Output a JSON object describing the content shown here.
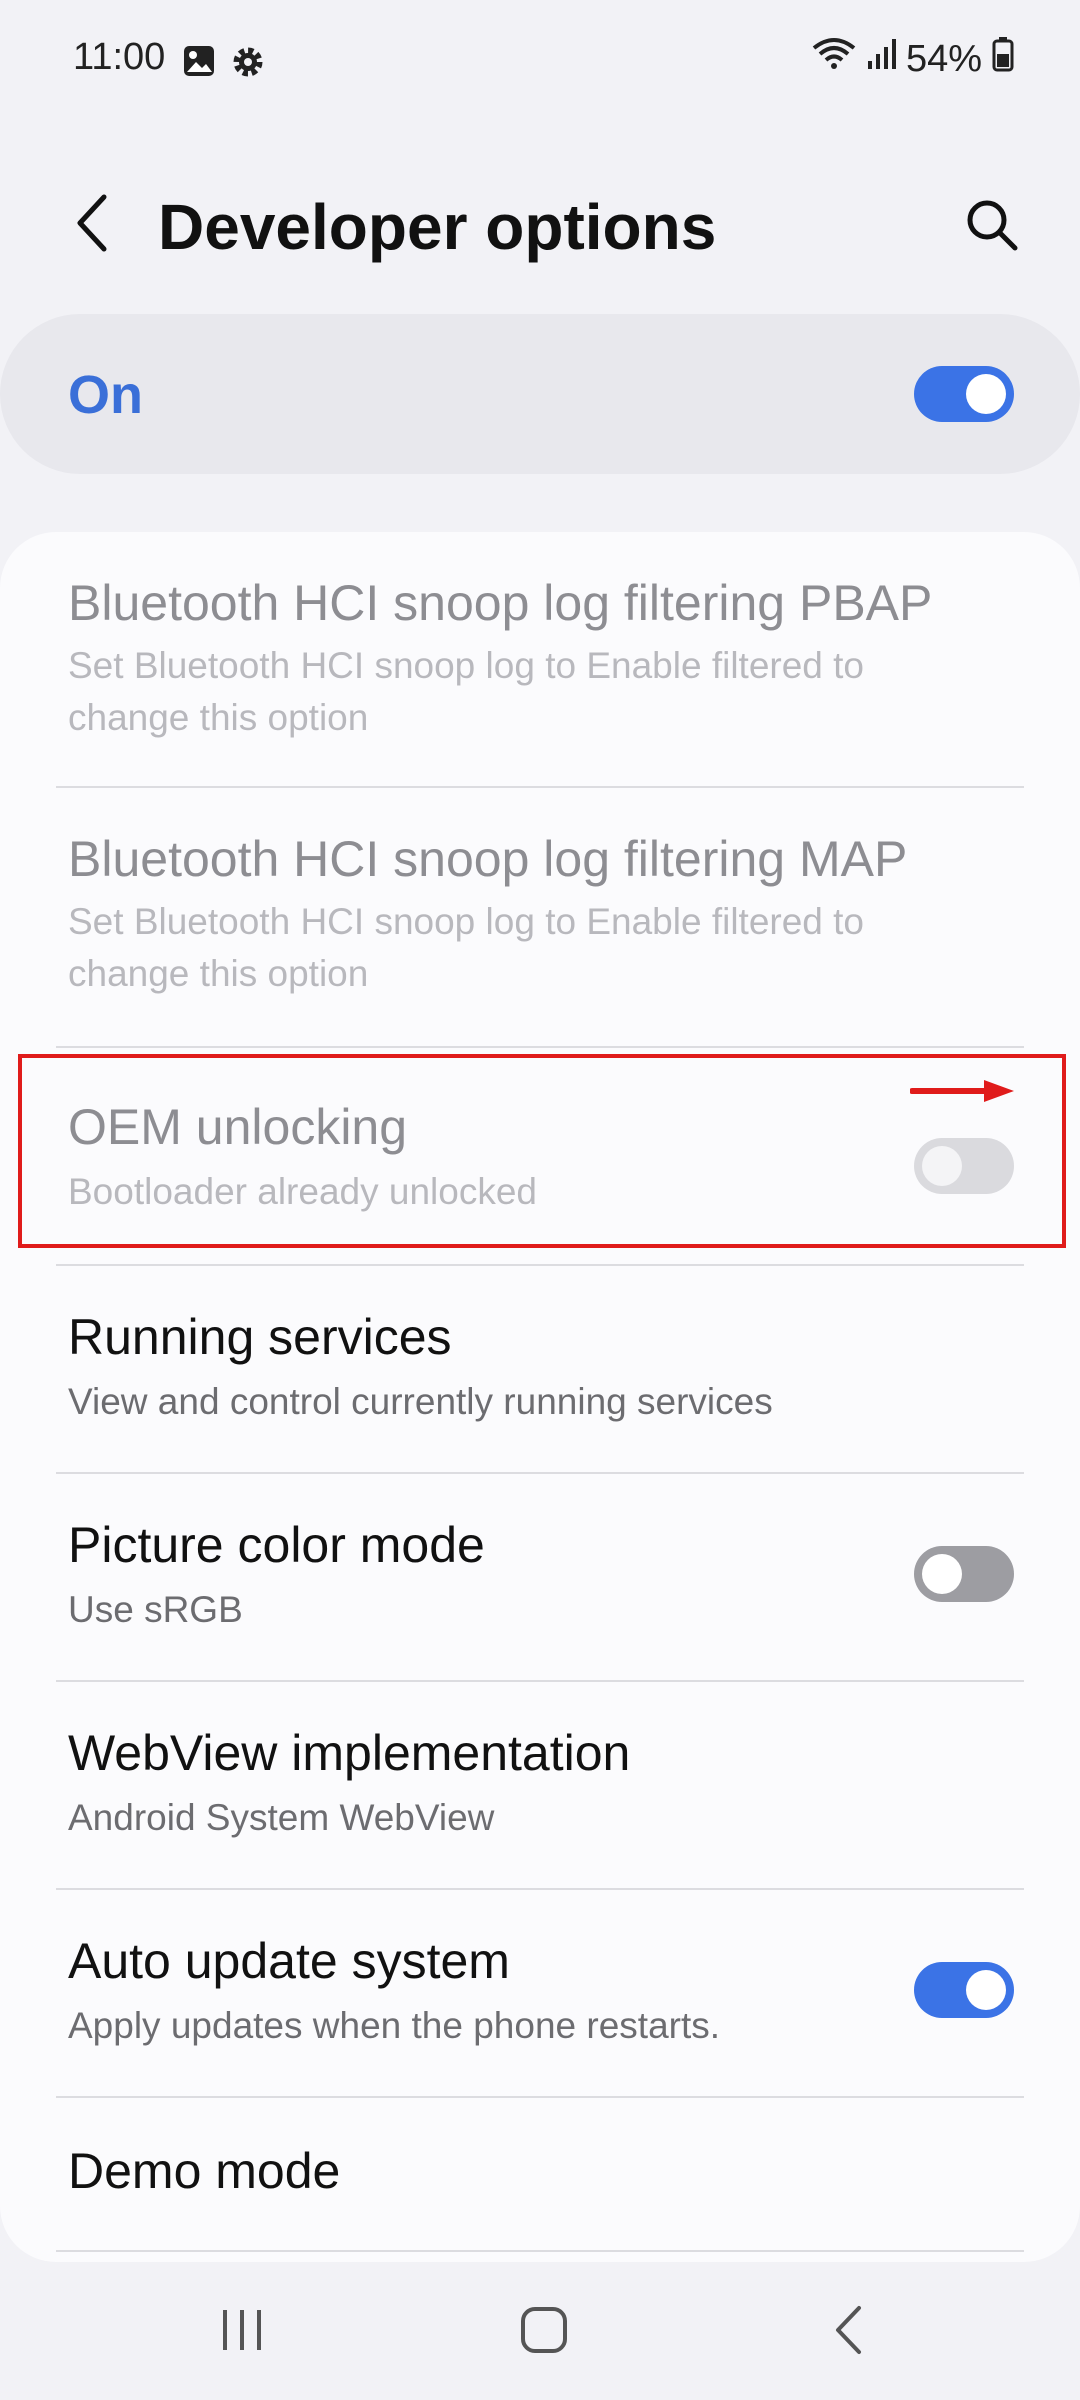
{
  "status_bar": {
    "time": "11:00",
    "battery": "54%",
    "icons": [
      "gallery-icon",
      "settings-gear-icon",
      "wifi-icon",
      "signal-icon",
      "battery-icon"
    ]
  },
  "header": {
    "title": "Developer options",
    "back_icon": "chevron-left-icon",
    "search_icon": "search-icon"
  },
  "master_switch": {
    "label": "On",
    "state": "on"
  },
  "items": [
    {
      "title": "Bluetooth HCI snoop log filtering PBAP",
      "subtitle": "Set Bluetooth HCI snoop log to Enable filtered to change this option",
      "enabled": false
    },
    {
      "title": "Bluetooth HCI snoop log filtering MAP",
      "subtitle": "Set Bluetooth HCI snoop log to Enable filtered to change this option",
      "enabled": false
    },
    {
      "title": "OEM unlocking",
      "subtitle": "Bootloader already unlocked",
      "enabled": false,
      "toggle": "off"
    },
    {
      "title": "Running services",
      "subtitle": "View and control currently running services",
      "enabled": true
    },
    {
      "title": "Picture color mode",
      "subtitle": "Use sRGB",
      "enabled": true,
      "toggle": "off"
    },
    {
      "title": "WebView implementation",
      "subtitle": "Android System WebView",
      "enabled": true
    },
    {
      "title": "Auto update system",
      "subtitle": "Apply updates when the phone restarts.",
      "enabled": true,
      "toggle": "on"
    },
    {
      "title": "Demo mode",
      "enabled": true
    }
  ],
  "nav_bar": {
    "buttons": [
      "recents-icon",
      "home-icon",
      "back-icon"
    ]
  },
  "colors": {
    "accent": "#3b73e6",
    "annotation": "#e01b1b"
  }
}
